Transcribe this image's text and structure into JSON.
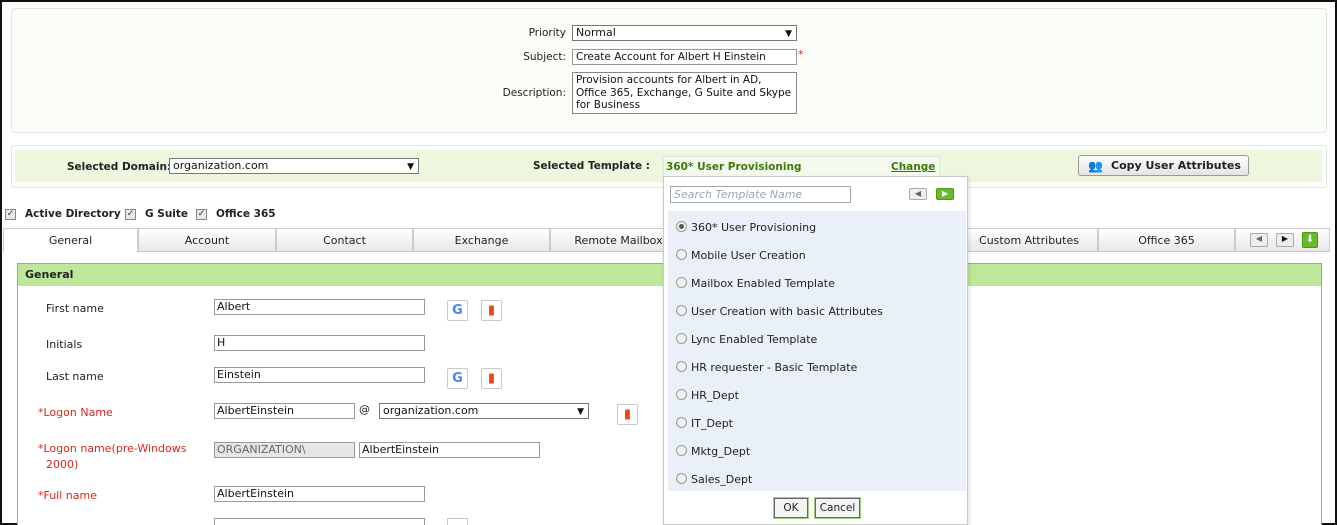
{
  "request": {
    "priority_label": "Priority",
    "priority_value": "Normal",
    "subject_label": "Subject:",
    "subject_value": "Create Account for Albert H Einstein",
    "description_label": "Description:",
    "description_value": "Provision accounts for Albert in AD, Office 365, Exchange, G Suite and Skype for Business"
  },
  "domain_bar": {
    "domain_label": "Selected Domain:",
    "domain_value": "organization.com",
    "template_label": "Selected Template :",
    "template_value": "360* User Provisioning",
    "change_label": "Change",
    "copy_button_label": "Copy User Attributes"
  },
  "targets": [
    {
      "label": "Active Directory",
      "checked": true
    },
    {
      "label": "G Suite",
      "checked": true
    },
    {
      "label": "Office 365",
      "checked": true
    }
  ],
  "tabs": [
    {
      "label": "General",
      "active": true
    },
    {
      "label": "Account"
    },
    {
      "label": "Contact"
    },
    {
      "label": "Exchange"
    },
    {
      "label": "Remote Mailbox"
    },
    {
      "label": "Custom Attributes"
    },
    {
      "label": "Office 365"
    }
  ],
  "general": {
    "section_title": "General",
    "first_name_label": "First name",
    "first_name_value": "Albert",
    "initials_label": "Initials",
    "initials_value": "H",
    "last_name_label": "Last name",
    "last_name_value": "Einstein",
    "logon_name_label": "*Logon Name",
    "logon_name_value": "AlbertEinstein",
    "at_symbol": "@",
    "logon_domain_value": "organization.com",
    "pre2000_label_1": "*Logon name(pre-Windows",
    "pre2000_label_2": "2000)",
    "pre2000_prefix": "ORGANIZATION\\",
    "pre2000_value": "AlbertEinstein",
    "full_name_label": "*Full name",
    "full_name_value": "AlbertEinstein"
  },
  "template_popup": {
    "search_placeholder": "Search Template Name",
    "options": [
      {
        "label": "360* User Provisioning",
        "selected": true
      },
      {
        "label": "Mobile User Creation"
      },
      {
        "label": "Mailbox Enabled Template"
      },
      {
        "label": "User Creation with basic Attributes"
      },
      {
        "label": "Lync Enabled Template"
      },
      {
        "label": "HR requester - Basic Template"
      },
      {
        "label": "HR_Dept"
      },
      {
        "label": "IT_Dept"
      },
      {
        "label": "Mktg_Dept"
      },
      {
        "label": "Sales_Dept"
      }
    ],
    "ok_label": "OK",
    "cancel_label": "Cancel"
  },
  "colors": {
    "accent_green": "#3c7a0a",
    "panel_header": "#bde89a",
    "required_red": "#d9261c"
  }
}
